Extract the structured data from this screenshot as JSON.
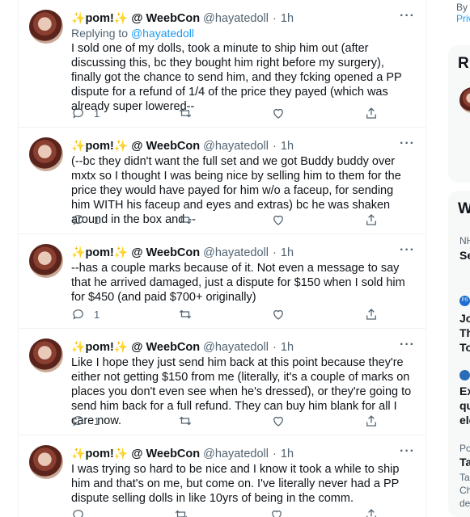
{
  "author": {
    "display_name": "pom!",
    "sparkle": "✨",
    "affiliation": "@ WeebCon",
    "handle": "@hayatedoll",
    "time": "1h"
  },
  "more_label": "···",
  "tweets": [
    {
      "reply_label": "Replying to",
      "reply_handle": "@hayatedoll",
      "text": "I sold one of my dolls, took a minute to ship him out (after discussing this, bc they bought him right before my surgery), finally got the chance to send him, and they fcking opened a PP dispute for a refund of 1/4 of the price they payed (which was already super lowered--",
      "reply_count": "1"
    },
    {
      "text": "(--bc they didn't want the full set and we got Buddy buddy over mxtx so I thought I was being nice by selling him to them for the price they would have payed for him w/o a faceup, for sending him WITH his faceup and eyes and extras) bc he was shaken around in the box and --",
      "reply_count": "1"
    },
    {
      "text": "--has a couple marks because of it. Not even a message to say that he arrived damaged, just a dispute for $150 when I sold him for $450 (and paid $700+ originally)",
      "reply_count": "1"
    },
    {
      "text": "Like I hope they just send him back at this point because they're either not getting $150 from me (literally, it's a couple of marks on places you don't even see when he's dressed), or they're going to send him back for a full refund. They can buy him blank for all I care now.",
      "reply_count": "1"
    },
    {
      "text": "I was trying so hard to be nice and I know it took a while to ship him and that's on me, but come on. I've literally never had a PP dispute selling dolls in like 10yrs of being in the comm.",
      "reply_count": ""
    }
  ],
  "right_panel": {
    "top_line_1": "By s",
    "top_line_2": "Priv",
    "section_head_1": "R",
    "section_head_2": "W",
    "trend_1_meta": "NH",
    "trend_1_title": "Se",
    "trend_2_badge": "PS",
    "trend_2_lines": [
      "Jo",
      "Th",
      "To"
    ],
    "trend_3_lines": [
      "Ex",
      "qu",
      "ele"
    ],
    "trend_4_meta": "Po",
    "trend_4_title": "Ta",
    "trend_4_lines": [
      "Ta",
      "Ch",
      "de"
    ]
  }
}
